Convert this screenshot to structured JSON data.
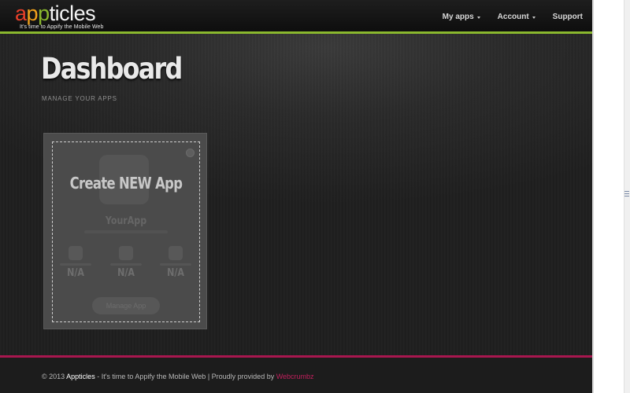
{
  "header": {
    "logo": {
      "letters": [
        {
          "char": "a",
          "color": "#e8402a"
        },
        {
          "char": "p",
          "color": "#f2a21b"
        },
        {
          "char": "p",
          "color": "#8ab82e"
        },
        {
          "char": "ticles",
          "color": "#f4f4f4"
        }
      ],
      "tagline": "It's time to Appify the Mobile Web"
    },
    "nav": [
      {
        "label": "My apps",
        "has_caret": true
      },
      {
        "label": "Account",
        "has_caret": true
      },
      {
        "label": "Support",
        "has_caret": false
      }
    ],
    "accent_color": "#8ab82e"
  },
  "main": {
    "title": "Dashboard",
    "subtitle": "MANAGE YOUR APPS",
    "create_card": {
      "title": "Create NEW App",
      "app_name": "YourApp",
      "stats": [
        {
          "icon": "phone-icon",
          "value": "N/A"
        },
        {
          "icon": "device-icon",
          "value": "N/A"
        },
        {
          "icon": "box-icon",
          "value": "N/A"
        }
      ],
      "manage_label": "Manage App"
    }
  },
  "footer": {
    "prefix": "© 2013 ",
    "brand": "Appticles",
    "middle": " - It's time to Appify the Mobile Web | Proudly provided by ",
    "link": "Webcrumbz",
    "accent_color": "#a8174f"
  }
}
